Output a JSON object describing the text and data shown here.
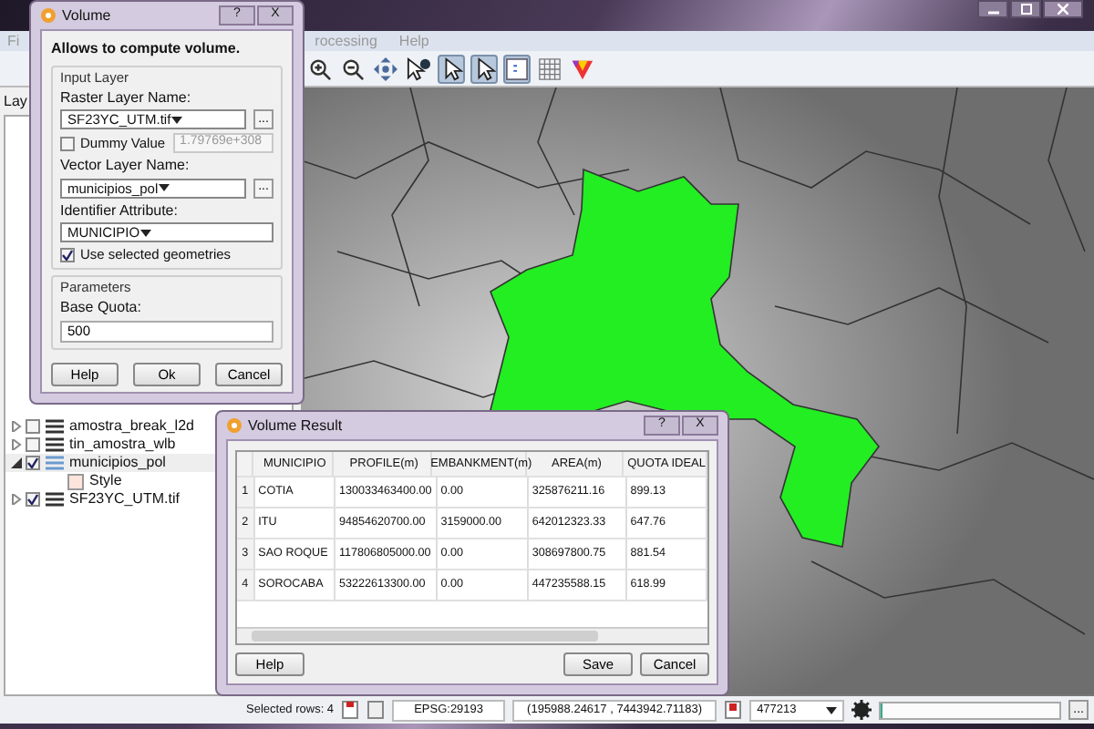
{
  "main_window": {
    "menu": [
      {
        "label": "Fi"
      },
      {
        "label": "rocessing"
      },
      {
        "label": "Help"
      }
    ],
    "toolbar": [
      {
        "kind": "zoom-in",
        "selected": false
      },
      {
        "kind": "zoom-out",
        "selected": false
      },
      {
        "kind": "pan",
        "selected": false
      },
      {
        "kind": "identify",
        "selected": false
      },
      {
        "kind": "select",
        "selected": true
      },
      {
        "kind": "select",
        "selected": true
      },
      {
        "kind": "table",
        "selected": true
      },
      {
        "kind": "grid",
        "selected": false
      },
      {
        "kind": "palette",
        "selected": false
      }
    ],
    "layers_panel": {
      "title": "Lay",
      "layers": [
        {
          "name": "amostra_break_l2d",
          "checked": false,
          "expanded": false
        },
        {
          "name": "tin_amostra_wlb",
          "checked": false,
          "expanded": false
        },
        {
          "name": "municipios_pol",
          "checked": true,
          "expanded": true,
          "children": [
            {
              "name": "Style"
            }
          ]
        },
        {
          "name": "SF23YC_UTM.tif",
          "checked": true,
          "expanded": false
        }
      ]
    },
    "status_bar": {
      "selection": "Selected rows: 4",
      "crs": "EPSG:29193",
      "coordinates": "(195988.24617 , 7443942.71183)",
      "scale": "477213",
      "progress": {
        "level": 0
      },
      "more_button": "..."
    }
  },
  "volume_dialog": {
    "title": "Volume",
    "help_icon": "?",
    "close_icon": "X",
    "heading": "Allows to compute volume.",
    "input_group": {
      "title": "Input Layer",
      "raster_label": "Raster Layer Name:",
      "raster_value": "SF23YC_UTM.tif",
      "raster_browse": "...",
      "dummy_label": "Dummy Value",
      "dummy_checked": false,
      "dummy_value": "1.79769e+308",
      "vector_label": "Vector Layer Name:",
      "vector_value": "municipios_pol",
      "vector_browse": "...",
      "identifier_label": "Identifier Attribute:",
      "identifier_value": "MUNICIPIO",
      "selected_label": "Use selected geometries",
      "selected_checked": true
    },
    "parameters_group": {
      "title": "Parameters",
      "quota_label": "Base Quota:",
      "quota_value": "500"
    },
    "buttons": [
      "Help",
      "Ok",
      "Cancel"
    ]
  },
  "result_dialog": {
    "title": "Volume Result",
    "help_icon": "?",
    "close_icon": "X",
    "table": {
      "columns": [
        "MUNICIPIO",
        "PROFILE(m)",
        "EMBANKMENT(m)",
        "AREA(m)",
        "QUOTA IDEAL"
      ],
      "rows": [
        {
          "number": "1",
          "cells": [
            "COTIA",
            "130033463400.00",
            "0.00",
            "325876211.16",
            "899.13"
          ]
        },
        {
          "number": "2",
          "cells": [
            "ITU",
            "94854620700.00",
            "3159000.00",
            "642012323.33",
            "647.76"
          ]
        },
        {
          "number": "3",
          "cells": [
            "SAO ROQUE",
            "117806805000.00",
            "0.00",
            "308697800.75",
            "881.54"
          ]
        },
        {
          "number": "4",
          "cells": [
            "SOROCABA",
            "53222613300.00",
            "0.00",
            "447235588.15",
            "618.99"
          ]
        }
      ]
    },
    "buttons": [
      "Help",
      "Save",
      "Cancel"
    ]
  }
}
